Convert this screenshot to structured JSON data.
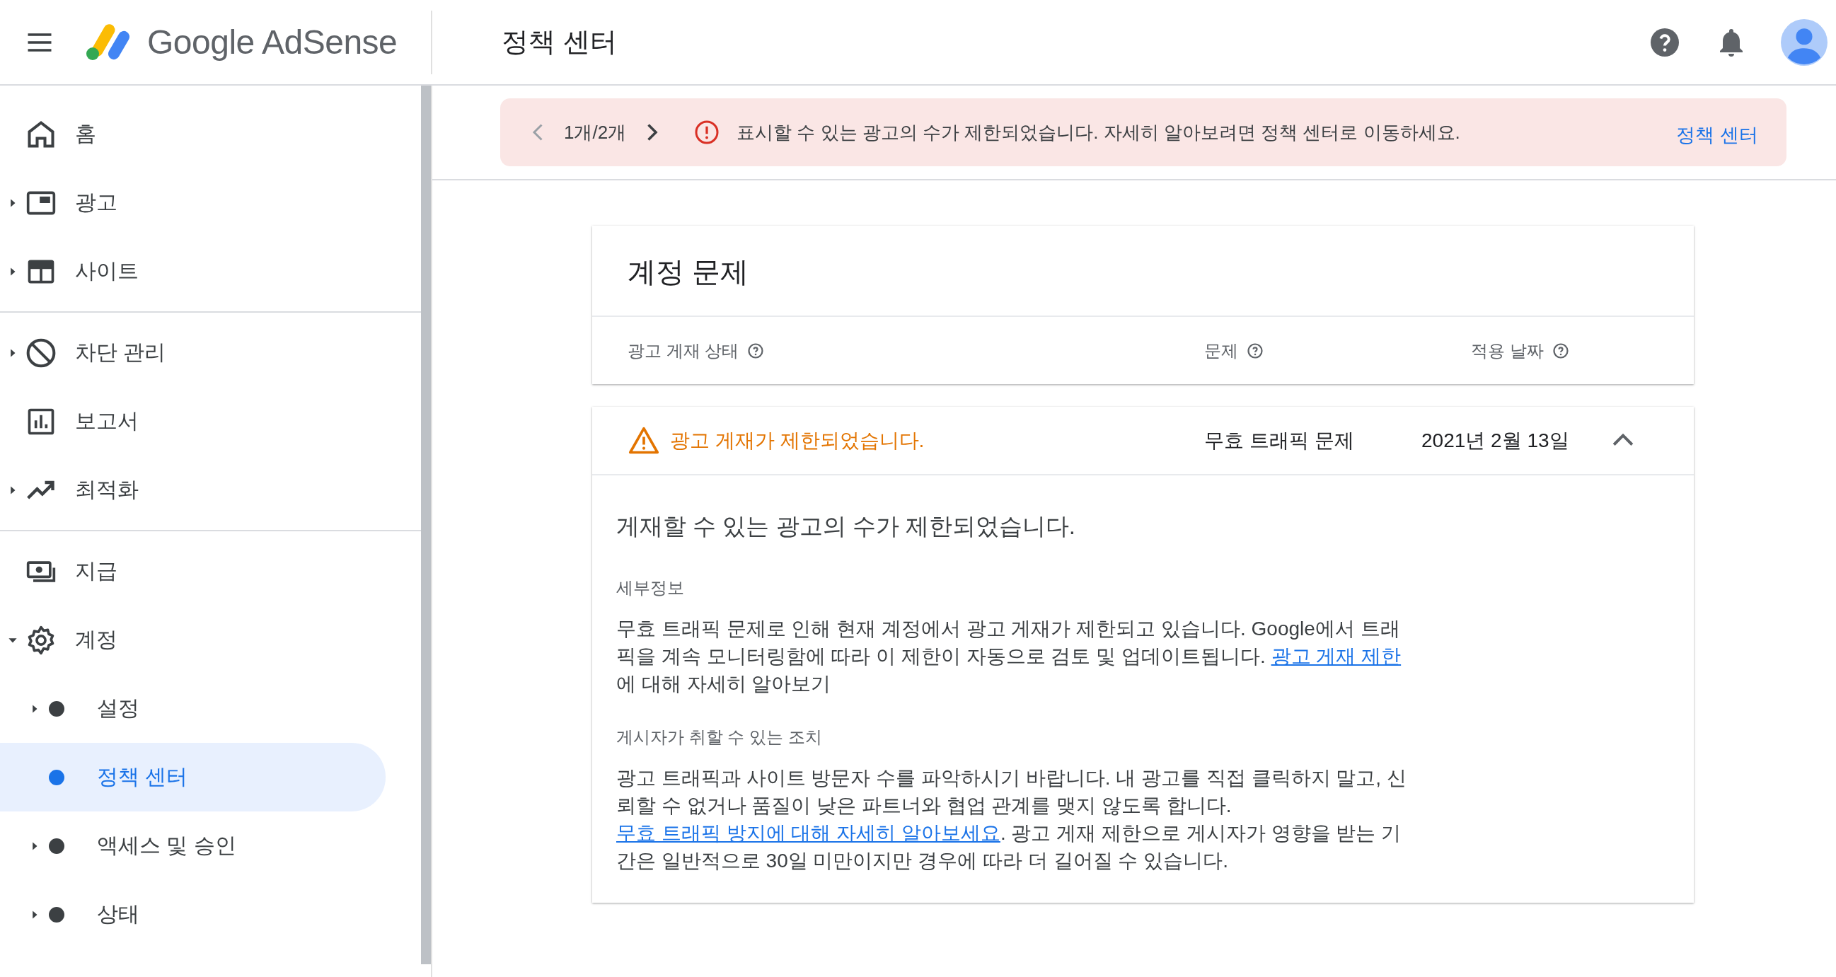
{
  "topbar": {
    "product": "Google AdSense",
    "title": "정책 센터"
  },
  "sidebar": {
    "sections": [
      {
        "items": [
          {
            "label": "홈",
            "kind": "home",
            "selected": false
          },
          {
            "label": "광고",
            "kind": "ads",
            "expanded": false,
            "selected": false
          },
          {
            "label": "사이트",
            "kind": "sites",
            "expanded": false,
            "selected": false
          }
        ]
      },
      {
        "items": [
          {
            "label": "차단 관리",
            "kind": "block",
            "expanded": false,
            "selected": false
          },
          {
            "label": "보고서",
            "kind": "reports",
            "selected": false
          },
          {
            "label": "최적화",
            "kind": "optimize",
            "expanded": false,
            "selected": false
          }
        ]
      },
      {
        "items": [
          {
            "label": "지급",
            "kind": "payments",
            "selected": false
          },
          {
            "label": "계정",
            "kind": "account",
            "expanded": true,
            "selected": false,
            "children": [
              {
                "label": "설정",
                "kind": "dot",
                "expanded": false,
                "selected": false
              },
              {
                "label": "정책 센터",
                "kind": "dot",
                "selected": true
              },
              {
                "label": "액세스 및 승인",
                "kind": "dot",
                "expanded": false,
                "selected": false
              },
              {
                "label": "상태",
                "kind": "dot",
                "expanded": false,
                "selected": false
              }
            ]
          }
        ]
      }
    ]
  },
  "banner": {
    "prev": {
      "disabled": true
    },
    "counter": "1개/2개",
    "next": {
      "disabled": false
    },
    "message": "표시할 수 있는 광고의 수가 제한되었습니다. 자세히 알아보려면 정책 센터로 이동하세요.",
    "action": "정책 센터"
  },
  "account_issues": {
    "title": "계정 문제",
    "columns": [
      {
        "label": "광고 게재 상태"
      },
      {
        "label": "문제"
      },
      {
        "label": "적용 날짜"
      }
    ],
    "issues": [
      {
        "status": "광고 게재가 제한되었습니다.",
        "issue": "무효 트래픽 문제",
        "date": "2021년 2월 13일",
        "expanded": true,
        "heading": "게재할 수 있는 광고의 수가 제한되었습니다.",
        "sections": [
          {
            "label": "세부정보",
            "text": "무효 트래픽 문제로 인해 현재 계정에서 광고 게재가 제한되고 있습니다. Google에서 트래픽을 계속 모니터링함에 따라 이 제한이 자동으로 검토 및 업데이트됩니다. ",
            "link": "광고 게재 제한",
            "after": "에 대해 자세히 알아보기"
          },
          {
            "label": "게시자가 취할 수 있는 조치",
            "text": "광고 트래픽과 사이트 방문자 수를 파악하시기 바랍니다. 내 광고를 직접 클릭하지 말고, 신뢰할 수 없거나 품질이 낮은 파트너와 협업 관계를 맺지 않도록 합니다. ",
            "link": "무효 트래픽 방지에 대해 자세히 알아보세요",
            "after": ". 광고 게재 제한으로 게시자가 영향을 받는 기간은 일반적으로 30일 미만이지만 경우에 따라 더 길어질 수 있습니다."
          }
        ]
      }
    ]
  }
}
